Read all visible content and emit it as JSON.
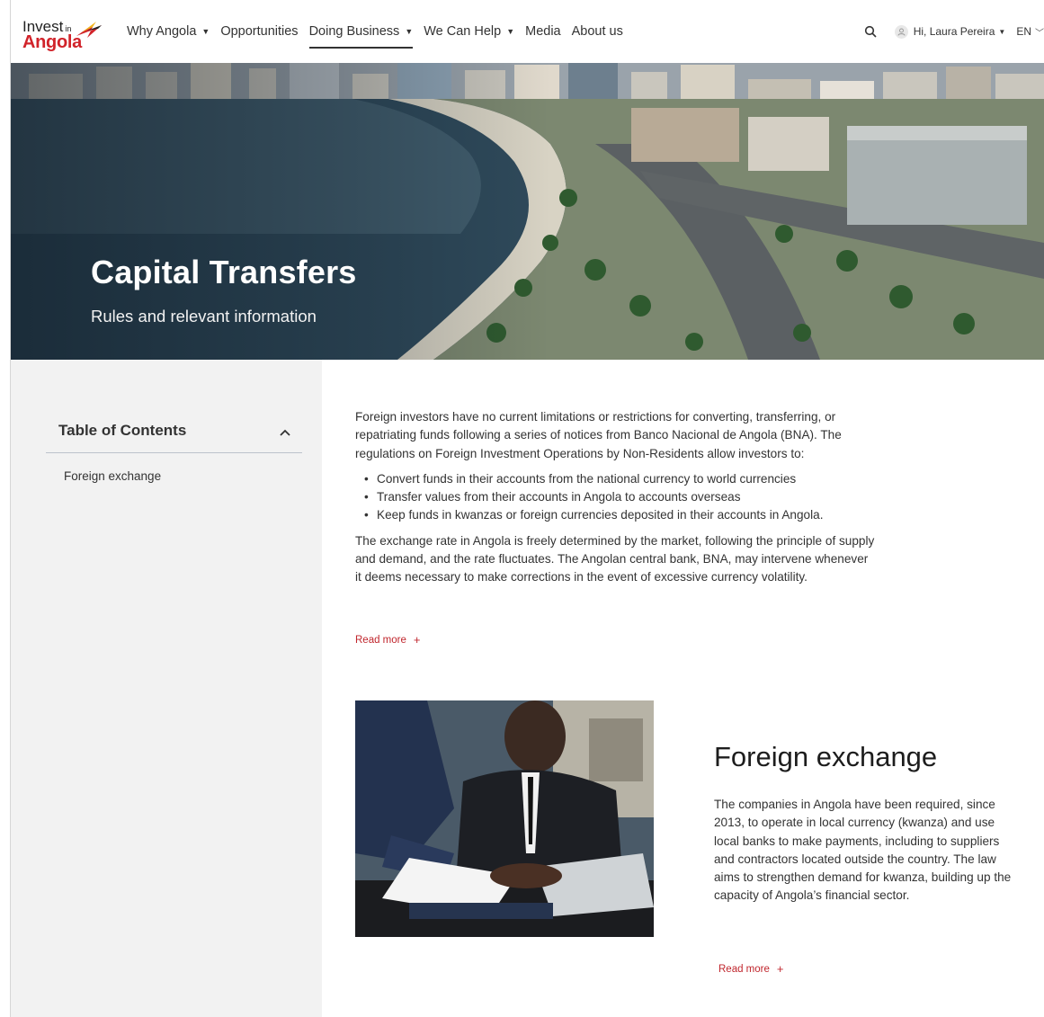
{
  "logo": {
    "line1": "Invest",
    "in": "in",
    "line2": "Angola"
  },
  "nav": {
    "items": [
      {
        "label": "Why Angola",
        "caret": "▼"
      },
      {
        "label": "Opportunities",
        "caret": ""
      },
      {
        "label": "Doing Business",
        "caret": "▼"
      },
      {
        "label": "We Can Help",
        "caret": "▼"
      },
      {
        "label": "Media",
        "caret": ""
      },
      {
        "label": "About us",
        "caret": ""
      }
    ],
    "active_item": "Doing Business",
    "user_greeting": "Hi, Laura Pereira",
    "language": "EN"
  },
  "hero": {
    "title": "Capital Transfers",
    "subtitle": "Rules and relevant information"
  },
  "toc": {
    "heading": "Table of Contents",
    "items": [
      "Foreign exchange"
    ]
  },
  "intro": {
    "paragraph1": "Foreign investors have no current limitations or restrictions for converting, transferring, or repatriating funds following a series of notices from Banco Nacional de Angola (BNA). The regulations on Foreign Investment Operations by Non-Residents allow investors to:",
    "bullets": [
      "Convert funds in their accounts from the national currency to world currencies",
      "Transfer values from their accounts in Angola to accounts overseas",
      "Keep funds in kwanzas or foreign currencies deposited in their accounts in Angola."
    ],
    "paragraph2": "The exchange rate in Angola is freely determined by the market, following the principle of supply and demand, and the rate fluctuates. The Angolan central bank, BNA, may intervene whenever it deems necessary to make corrections in the event of excessive currency volatility.",
    "read_more": "Read more",
    "plus": "+"
  },
  "foreign_exchange": {
    "title": "Foreign exchange",
    "text": "The companies in Angola have been required, since 2013, to operate in local currency (kwanza) and use local banks to make payments, including to suppliers and contractors located outside the country. The law aims to strengthen demand for kwanza, building up the capacity of Angola’s financial sector.",
    "read_more": "Read more",
    "plus": "+"
  },
  "colors": {
    "accent": "#c0262d",
    "sidebar_bg": "#f2f2f2",
    "logo_red": "#d1232a"
  }
}
